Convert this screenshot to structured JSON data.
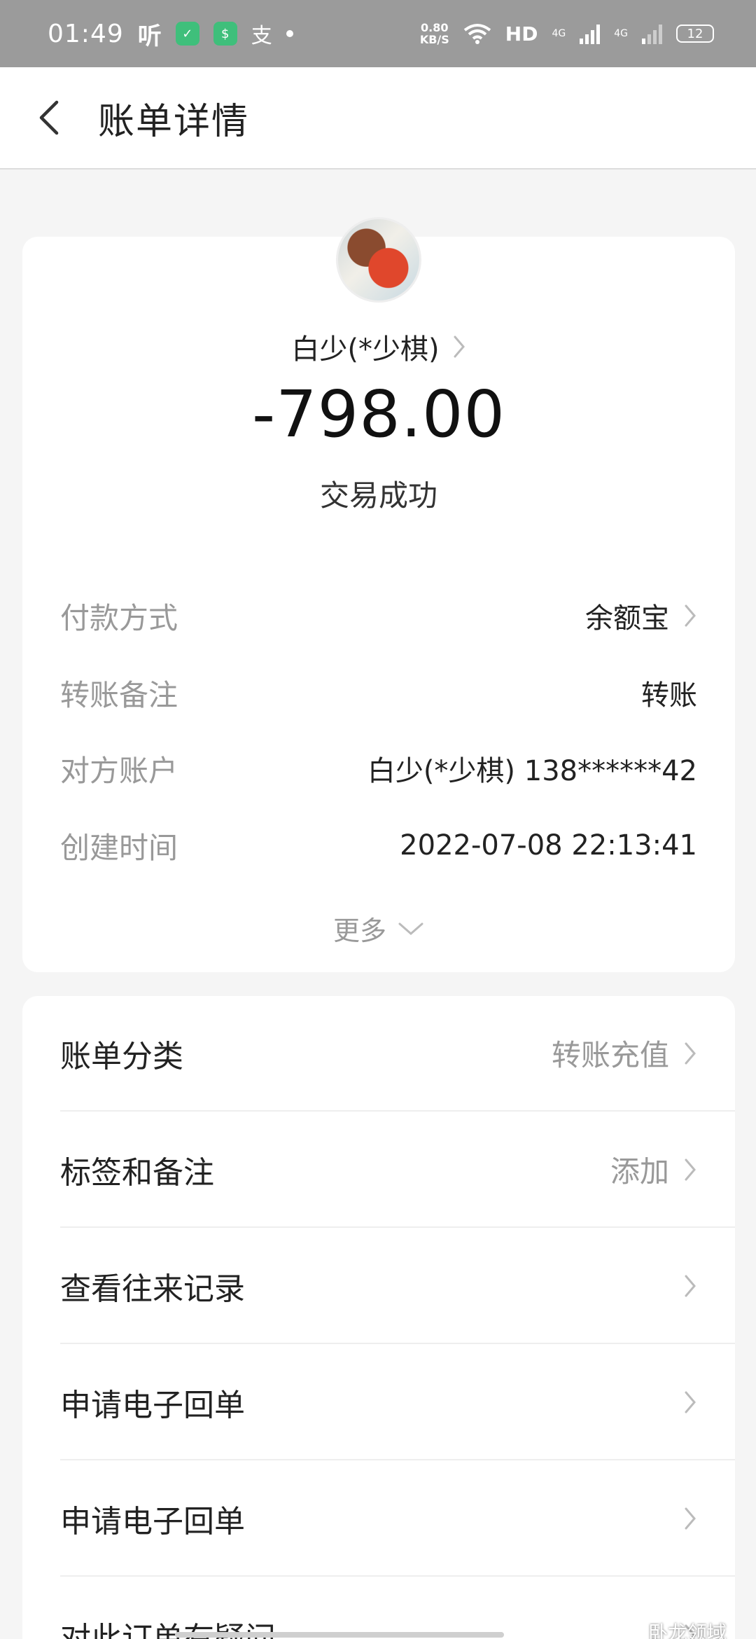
{
  "status_bar": {
    "time": "01:49",
    "listen": "听",
    "alipay_glyph": "支",
    "speed_value": "0.80",
    "speed_unit": "KB/S",
    "hd": "HD",
    "net1": "4G",
    "net2": "4G",
    "battery": "12"
  },
  "header": {
    "title": "账单详情"
  },
  "summary": {
    "payee": "白少(*少棋)",
    "amount": "-798.00",
    "status": "交易成功"
  },
  "details": [
    {
      "label": "付款方式",
      "value": "余额宝",
      "has_arrow": true
    },
    {
      "label": "转账备注",
      "value": "转账",
      "has_arrow": false
    },
    {
      "label": "对方账户",
      "value": "白少(*少棋) 138******42",
      "has_arrow": false
    },
    {
      "label": "创建时间",
      "value": "2022-07-08 22:13:41",
      "has_arrow": false
    }
  ],
  "more": {
    "label": "更多"
  },
  "menu": [
    {
      "label": "账单分类",
      "value": "转账充值"
    },
    {
      "label": "标签和备注",
      "value": "添加"
    },
    {
      "label": "查看往来记录",
      "value": ""
    },
    {
      "label": "申请电子回单",
      "value": ""
    },
    {
      "label": "申请电子回单",
      "value": ""
    },
    {
      "label": "对此订单有疑问",
      "value": ""
    }
  ],
  "watermark": "卧龙领域",
  "icons": {
    "back": "chevron-left-icon",
    "arrow": "chevron-right-icon",
    "more": "chevron-down-icon"
  }
}
